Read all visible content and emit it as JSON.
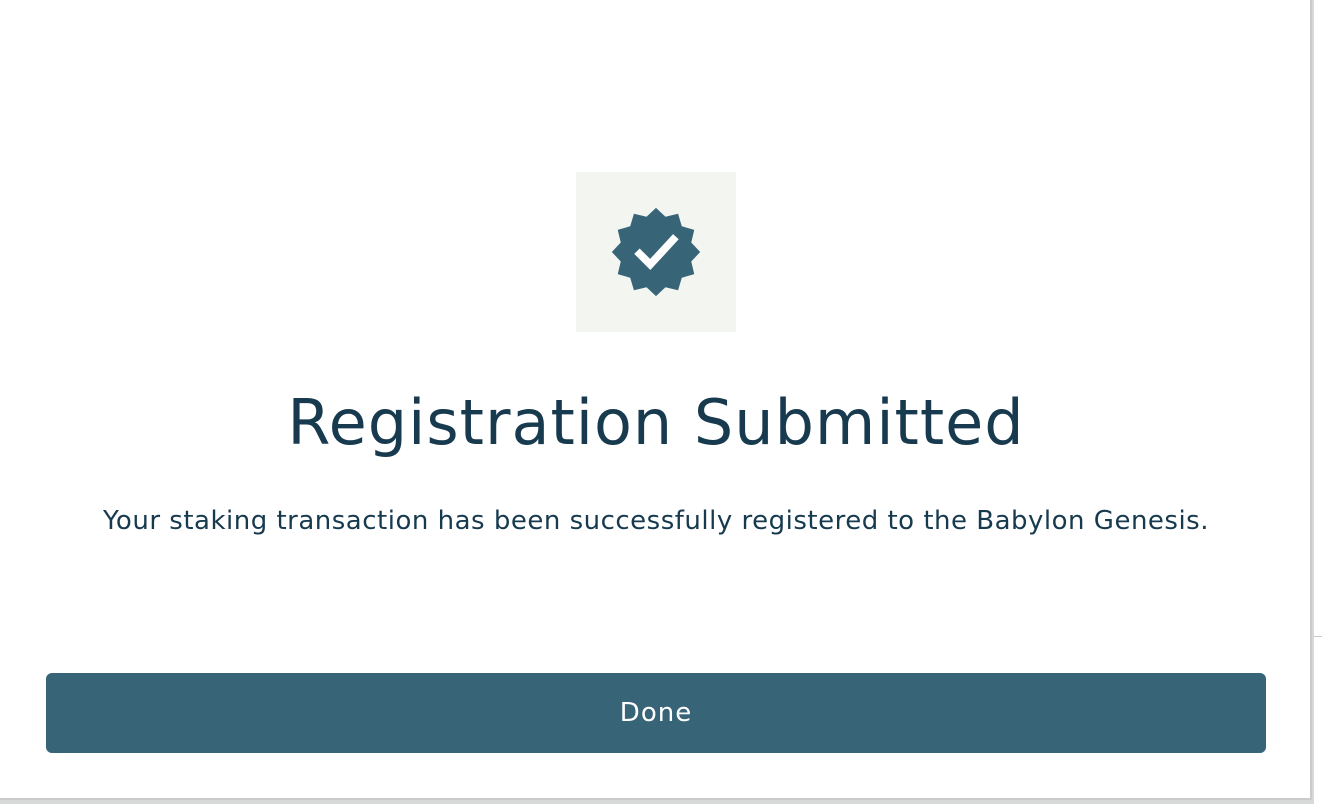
{
  "dialog": {
    "icon": "verified-badge-check-icon",
    "title": "Registration Submitted",
    "message": "Your staking transaction has been successfully registered to the Babylon Genesis.",
    "done_label": "Done"
  },
  "colors": {
    "accent": "#376477",
    "text": "#173a4f",
    "icon_background": "#f2f5f0",
    "badge": "#376477"
  }
}
